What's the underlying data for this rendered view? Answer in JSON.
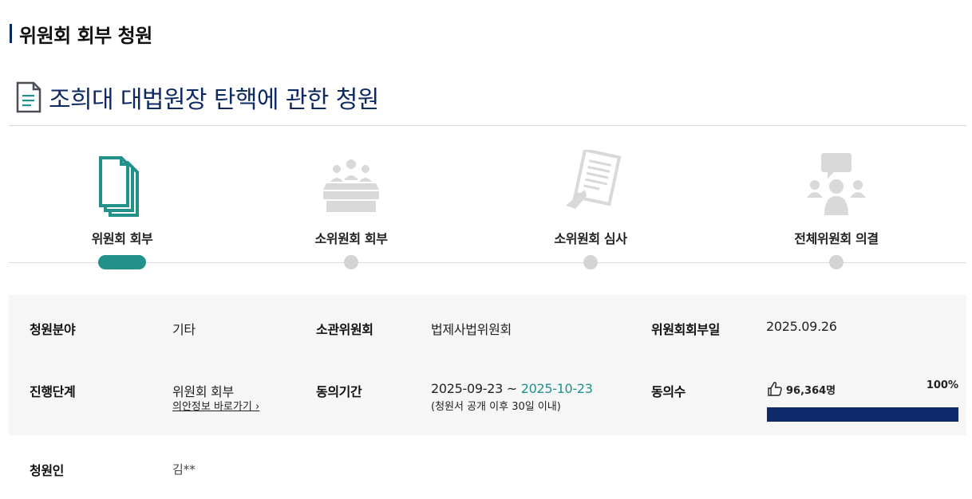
{
  "section": {
    "title": "위원회 회부 청원"
  },
  "petition": {
    "title": "조희대 대법원장 탄핵에 관한 청원",
    "icon": "document-icon"
  },
  "steps": [
    {
      "label": "위원회 회부",
      "icon": "documents-stack-icon",
      "active": true
    },
    {
      "label": "소위원회 회부",
      "icon": "meeting-table-icon",
      "active": false
    },
    {
      "label": "소위원회 심사",
      "icon": "review-document-icon",
      "active": false
    },
    {
      "label": "전체위원회 의결",
      "icon": "assembly-discussion-icon",
      "active": false
    }
  ],
  "colors": {
    "accent": "#21918a",
    "navy": "#0e2a6b",
    "title": "#0e2a63",
    "inactive": "#d4d4d4"
  },
  "info": {
    "field_label": "청원분야",
    "field_value": "기타",
    "committee_label": "소관위원회",
    "committee_value": "법제사법위원회",
    "referral_date_label": "위원회회부일",
    "referral_date_value": "2025.09.26",
    "stage_label": "진행단계",
    "stage_value": "위원회 회부",
    "stage_link": "의안정보 바로가기 ›",
    "period_label": "동의기간",
    "period_start": "2025-09-23 ~",
    "period_end": "2025-10-23",
    "period_note": "(청원서 공개 이후 30일 이내)",
    "agree_label": "동의수",
    "agree_count": "96,364명",
    "agree_percent_text": "100%",
    "agree_percent": 100,
    "petitioner_label": "청원인",
    "petitioner_value": "김**"
  }
}
